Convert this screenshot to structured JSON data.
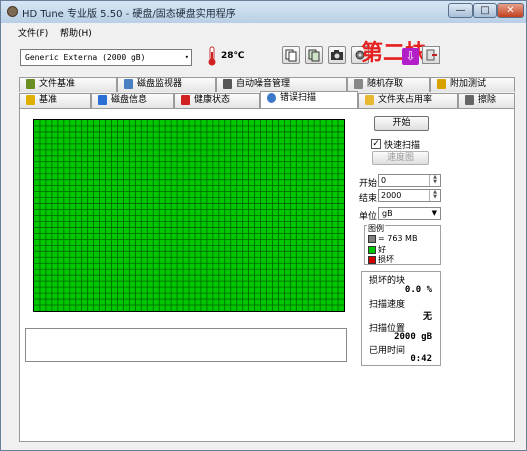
{
  "window": {
    "title": "HD Tune 专业版 5.50 - 硬盘/固态硬盘实用程序",
    "buttons": {
      "minimize": "—",
      "maximize": "□",
      "close": "✕"
    }
  },
  "menu": {
    "file": "文件(F)",
    "help": "帮助(H)"
  },
  "toolbar": {
    "drive": "Generic Externa   (2000 gB)",
    "drive_arrow": "▾",
    "temperature": "28℃",
    "icons": [
      "copy-info-icon",
      "copy-screen-icon",
      "camera-icon",
      "options-icon",
      "exit-icon"
    ],
    "watermark": "第二块",
    "watermark_arrow": "⇩"
  },
  "tabs_top": [
    {
      "label": "文件基准",
      "icon": "file-benchmark-icon",
      "color": "#6b8e23"
    },
    {
      "label": "磁盘监视器",
      "icon": "disk-monitor-icon",
      "color": "#4a7fc1"
    },
    {
      "label": "自动噪音管理",
      "icon": "speaker-icon",
      "color": "#555555"
    },
    {
      "label": "随机存取",
      "icon": "random-access-icon",
      "color": "#888888"
    },
    {
      "label": "附加测试",
      "icon": "extra-tests-icon",
      "color": "#d9a100"
    }
  ],
  "tabs_bottom": [
    {
      "label": "基准",
      "icon": "benchmark-icon",
      "color": "#e0b000"
    },
    {
      "label": "磁盘信息",
      "icon": "info-icon",
      "color": "#2a6fd6"
    },
    {
      "label": "健康状态",
      "icon": "health-cross-icon",
      "color": "#d02020"
    },
    {
      "label": "错误扫描",
      "icon": "magnifier-icon",
      "color": "#3c78c8",
      "active": true
    },
    {
      "label": "文件夹占用率",
      "icon": "folder-icon",
      "color": "#e8b830"
    },
    {
      "label": "擦除",
      "icon": "trash-icon",
      "color": "#666666"
    }
  ],
  "scan": {
    "blocks_ok_color": "#00c800",
    "grid_line_color": "#006400",
    "start_button": "开始",
    "quick_scan_label": "快速扫描",
    "quick_scan_checked": "✓",
    "speed_map_button": "速度图",
    "start_label": "开始",
    "start_value": "0",
    "end_label": "结束",
    "end_value": "2000",
    "unit_label": "单位",
    "unit_value": "gB",
    "legend_title": "图例",
    "legend_block": "= 763 MB",
    "legend_ok": "好",
    "legend_bad": "损坏",
    "colors": {
      "block": "#808080",
      "ok": "#00c800",
      "bad": "#d00000"
    },
    "stats": {
      "damaged_label": "损坏的块",
      "damaged_value": "0.0 %",
      "scan_speed_label": "扫描速度",
      "scan_speed_value": "无",
      "scan_position_label": "扫描位置",
      "scan_position_value": "2000 gB",
      "elapsed_label": "已用时间",
      "elapsed_value": "0:42"
    }
  }
}
